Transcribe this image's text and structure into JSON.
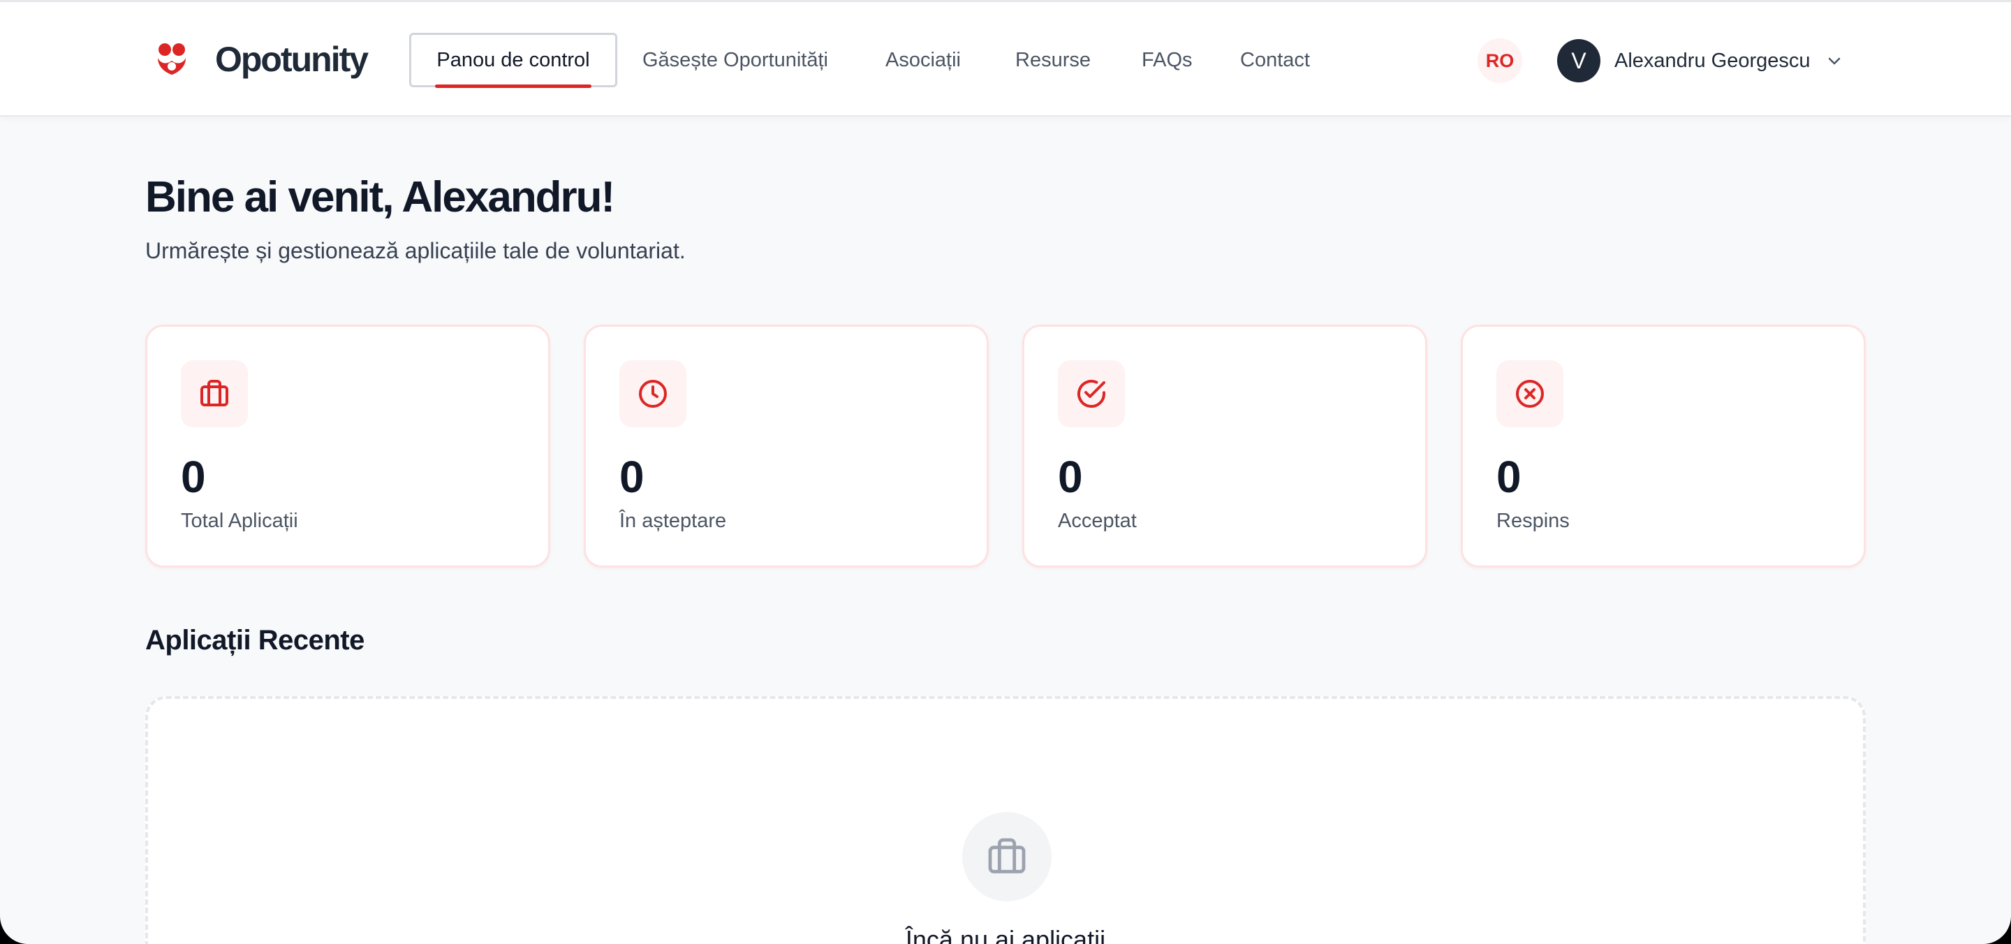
{
  "brand": {
    "name": "Opotunity",
    "accent_color": "#dc2626"
  },
  "nav": {
    "items": [
      {
        "label": "Panou de control",
        "active": true
      },
      {
        "label": "Găsește Oportunități",
        "active": false
      },
      {
        "label": "Asociații",
        "active": false
      },
      {
        "label": "Resurse",
        "active": false
      },
      {
        "label": "FAQs",
        "active": false
      },
      {
        "label": "Contact",
        "active": false
      }
    ]
  },
  "header": {
    "language": "RO",
    "user": {
      "initial": "V",
      "name": "Alexandru Georgescu"
    }
  },
  "welcome": {
    "title": "Bine ai venit, Alexandru!",
    "subtitle": "Urmărește și gestionează aplicațiile tale de voluntariat."
  },
  "stats": [
    {
      "icon": "briefcase-icon",
      "value": "0",
      "label": "Total Aplicații"
    },
    {
      "icon": "clock-icon",
      "value": "0",
      "label": "În așteptare"
    },
    {
      "icon": "check-circle-icon",
      "value": "0",
      "label": "Acceptat"
    },
    {
      "icon": "x-circle-icon",
      "value": "0",
      "label": "Respins"
    }
  ],
  "recent": {
    "title": "Aplicații Recente",
    "empty_icon": "briefcase-icon",
    "empty_text": "Încă nu ai aplicații"
  }
}
